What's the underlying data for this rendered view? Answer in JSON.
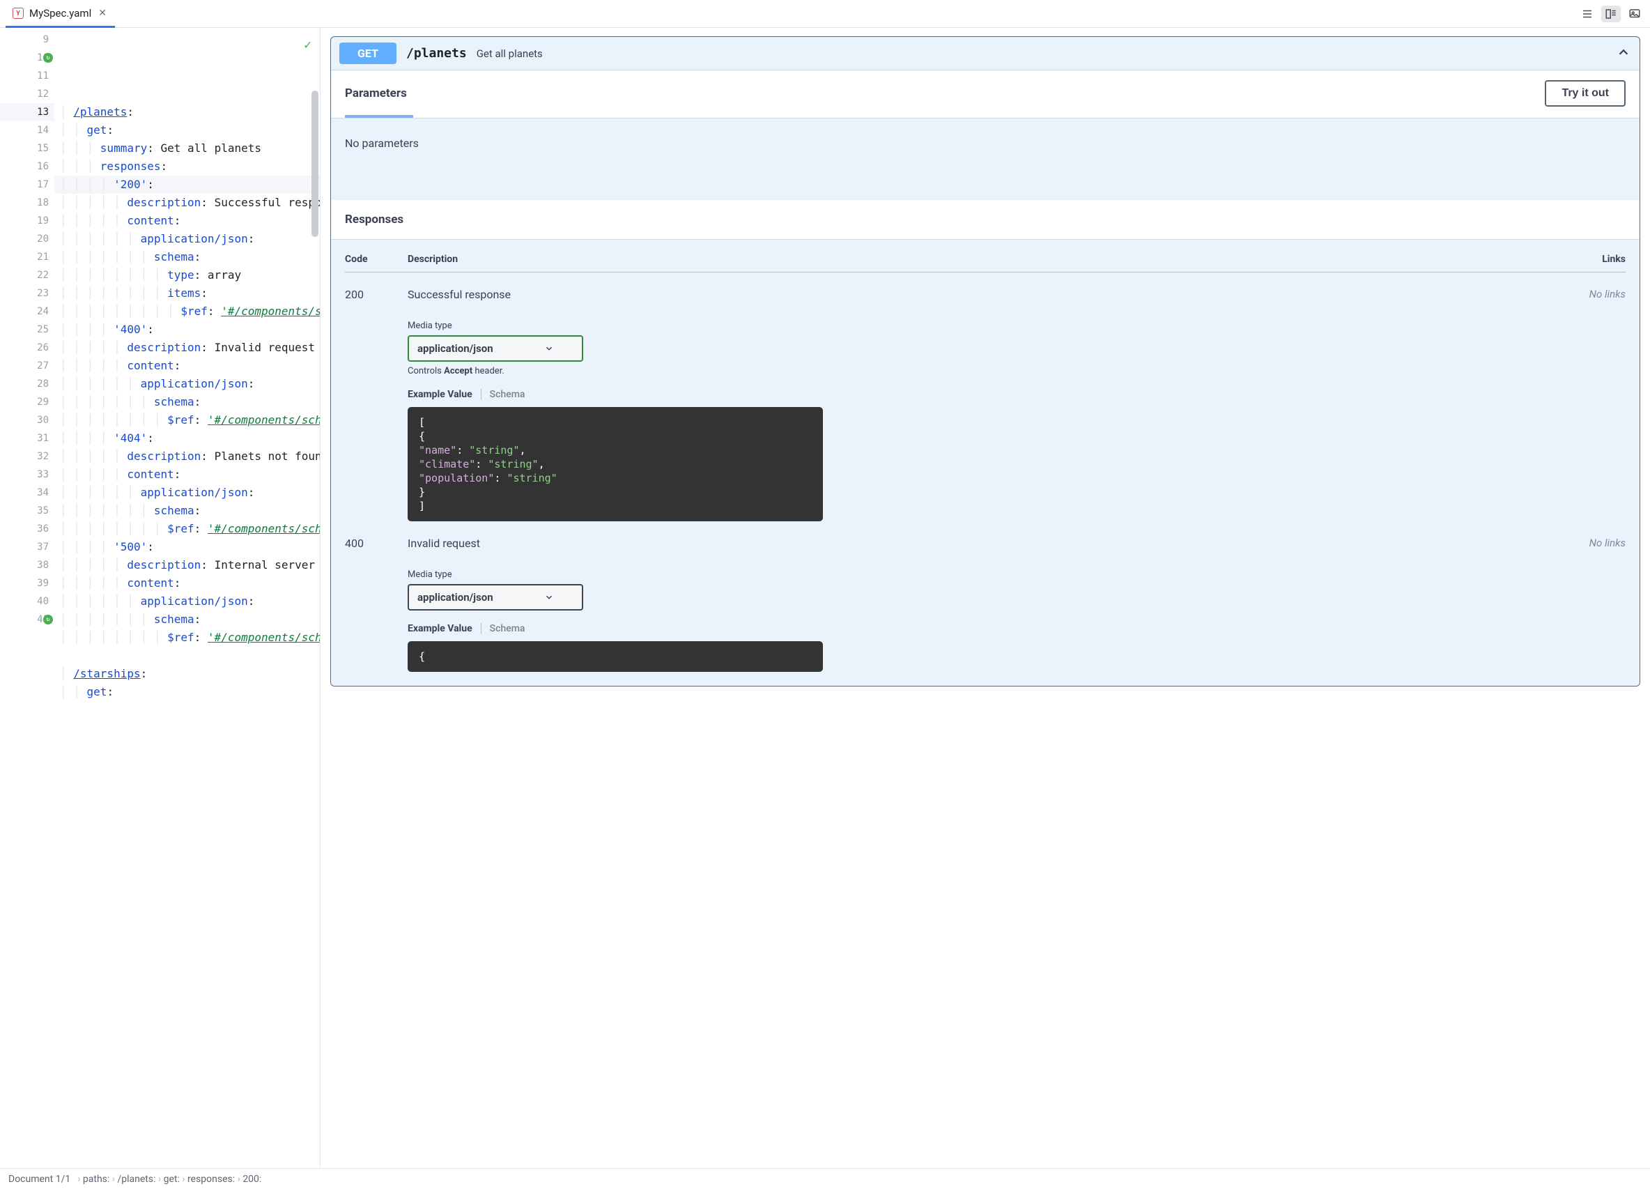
{
  "tab": {
    "filename": "MySpec.yaml"
  },
  "editor": {
    "lines": [
      {
        "n": 9,
        "indent": 1,
        "tokens": [
          {
            "t": "path",
            "v": "/planets"
          },
          {
            "t": "colon",
            "v": ":"
          }
        ]
      },
      {
        "n": 10,
        "indent": 2,
        "gutterMark": true,
        "tokens": [
          {
            "t": "key",
            "v": "get"
          },
          {
            "t": "colon",
            "v": ":"
          }
        ]
      },
      {
        "n": 11,
        "indent": 3,
        "tokens": [
          {
            "t": "key",
            "v": "summary"
          },
          {
            "t": "colon",
            "v": ": "
          },
          {
            "t": "str",
            "v": "Get all planets"
          }
        ]
      },
      {
        "n": 12,
        "indent": 3,
        "tokens": [
          {
            "t": "key",
            "v": "responses"
          },
          {
            "t": "colon",
            "v": ":"
          }
        ]
      },
      {
        "n": 13,
        "indent": 4,
        "current": true,
        "tokens": [
          {
            "t": "quoted",
            "v": "'200'"
          },
          {
            "t": "colon",
            "v": ":"
          }
        ]
      },
      {
        "n": 14,
        "indent": 5,
        "tokens": [
          {
            "t": "key",
            "v": "description"
          },
          {
            "t": "colon",
            "v": ": "
          },
          {
            "t": "str",
            "v": "Successful response"
          }
        ]
      },
      {
        "n": 15,
        "indent": 5,
        "tokens": [
          {
            "t": "key",
            "v": "content"
          },
          {
            "t": "colon",
            "v": ":"
          }
        ]
      },
      {
        "n": 16,
        "indent": 6,
        "tokens": [
          {
            "t": "key",
            "v": "application/json"
          },
          {
            "t": "colon",
            "v": ":"
          }
        ]
      },
      {
        "n": 17,
        "indent": 7,
        "tokens": [
          {
            "t": "key",
            "v": "schema"
          },
          {
            "t": "colon",
            "v": ":"
          }
        ]
      },
      {
        "n": 18,
        "indent": 8,
        "tokens": [
          {
            "t": "key",
            "v": "type"
          },
          {
            "t": "colon",
            "v": ": "
          },
          {
            "t": "str",
            "v": "array"
          }
        ]
      },
      {
        "n": 19,
        "indent": 8,
        "tokens": [
          {
            "t": "key",
            "v": "items"
          },
          {
            "t": "colon",
            "v": ":"
          }
        ]
      },
      {
        "n": 20,
        "indent": 9,
        "tokens": [
          {
            "t": "key",
            "v": "$ref"
          },
          {
            "t": "colon",
            "v": ": "
          },
          {
            "t": "ref",
            "v": "'#/components/sche"
          }
        ]
      },
      {
        "n": 21,
        "indent": 4,
        "tokens": [
          {
            "t": "quoted",
            "v": "'400'"
          },
          {
            "t": "colon",
            "v": ":"
          }
        ]
      },
      {
        "n": 22,
        "indent": 5,
        "tokens": [
          {
            "t": "key",
            "v": "description"
          },
          {
            "t": "colon",
            "v": ": "
          },
          {
            "t": "str",
            "v": "Invalid request"
          }
        ]
      },
      {
        "n": 23,
        "indent": 5,
        "tokens": [
          {
            "t": "key",
            "v": "content"
          },
          {
            "t": "colon",
            "v": ":"
          }
        ]
      },
      {
        "n": 24,
        "indent": 6,
        "tokens": [
          {
            "t": "key",
            "v": "application/json"
          },
          {
            "t": "colon",
            "v": ":"
          }
        ]
      },
      {
        "n": 25,
        "indent": 7,
        "tokens": [
          {
            "t": "key",
            "v": "schema"
          },
          {
            "t": "colon",
            "v": ":"
          }
        ]
      },
      {
        "n": 26,
        "indent": 8,
        "tokens": [
          {
            "t": "key",
            "v": "$ref"
          },
          {
            "t": "colon",
            "v": ": "
          },
          {
            "t": "ref",
            "v": "'#/components/schema"
          }
        ]
      },
      {
        "n": 27,
        "indent": 4,
        "tokens": [
          {
            "t": "quoted",
            "v": "'404'"
          },
          {
            "t": "colon",
            "v": ":"
          }
        ]
      },
      {
        "n": 28,
        "indent": 5,
        "tokens": [
          {
            "t": "key",
            "v": "description"
          },
          {
            "t": "colon",
            "v": ": "
          },
          {
            "t": "str",
            "v": "Planets not found"
          }
        ]
      },
      {
        "n": 29,
        "indent": 5,
        "tokens": [
          {
            "t": "key",
            "v": "content"
          },
          {
            "t": "colon",
            "v": ":"
          }
        ]
      },
      {
        "n": 30,
        "indent": 6,
        "tokens": [
          {
            "t": "key",
            "v": "application/json"
          },
          {
            "t": "colon",
            "v": ":"
          }
        ]
      },
      {
        "n": 31,
        "indent": 7,
        "tokens": [
          {
            "t": "key",
            "v": "schema"
          },
          {
            "t": "colon",
            "v": ":"
          }
        ]
      },
      {
        "n": 32,
        "indent": 8,
        "tokens": [
          {
            "t": "key",
            "v": "$ref"
          },
          {
            "t": "colon",
            "v": ": "
          },
          {
            "t": "ref",
            "v": "'#/components/schema"
          }
        ]
      },
      {
        "n": 33,
        "indent": 4,
        "tokens": [
          {
            "t": "quoted",
            "v": "'500'"
          },
          {
            "t": "colon",
            "v": ":"
          }
        ]
      },
      {
        "n": 34,
        "indent": 5,
        "tokens": [
          {
            "t": "key",
            "v": "description"
          },
          {
            "t": "colon",
            "v": ": "
          },
          {
            "t": "str",
            "v": "Internal server err"
          }
        ]
      },
      {
        "n": 35,
        "indent": 5,
        "tokens": [
          {
            "t": "key",
            "v": "content"
          },
          {
            "t": "colon",
            "v": ":"
          }
        ]
      },
      {
        "n": 36,
        "indent": 6,
        "tokens": [
          {
            "t": "key",
            "v": "application/json"
          },
          {
            "t": "colon",
            "v": ":"
          }
        ]
      },
      {
        "n": 37,
        "indent": 7,
        "tokens": [
          {
            "t": "key",
            "v": "schema"
          },
          {
            "t": "colon",
            "v": ":"
          }
        ]
      },
      {
        "n": 38,
        "indent": 8,
        "tokens": [
          {
            "t": "key",
            "v": "$ref"
          },
          {
            "t": "colon",
            "v": ": "
          },
          {
            "t": "ref",
            "v": "'#/components/schema"
          }
        ]
      },
      {
        "n": 39,
        "indent": 0,
        "tokens": []
      },
      {
        "n": 40,
        "indent": 1,
        "tokens": [
          {
            "t": "path",
            "v": "/starships"
          },
          {
            "t": "colon",
            "v": ":"
          }
        ]
      },
      {
        "n": 41,
        "indent": 2,
        "gutterMark": true,
        "tokens": [
          {
            "t": "key",
            "v": "get"
          },
          {
            "t": "colon",
            "v": ":"
          }
        ]
      }
    ]
  },
  "preview": {
    "method": "GET",
    "path": "/planets",
    "summary": "Get all planets",
    "sections": {
      "parameters": "Parameters",
      "responses": "Responses"
    },
    "try_label": "Try it out",
    "no_params": "No parameters",
    "table_head": {
      "code": "Code",
      "desc": "Description",
      "links": "Links"
    },
    "no_links": "No links",
    "media_label": "Media type",
    "media_value": "application/json",
    "accept_note_pre": "Controls ",
    "accept_note_bold": "Accept",
    "accept_note_post": " header.",
    "ev_tab_active": "Example Value",
    "ev_tab_inactive": "Schema",
    "responses": [
      {
        "code": "200",
        "desc": "Successful response",
        "mediaGreen": true,
        "showAcceptNote": true,
        "example": [
          [
            {
              "t": "punct",
              "v": "["
            }
          ],
          [
            {
              "t": "punct",
              "v": "  {"
            }
          ],
          [
            {
              "t": "punct",
              "v": "    "
            },
            {
              "t": "key",
              "v": "\"name\""
            },
            {
              "t": "punct",
              "v": ": "
            },
            {
              "t": "str",
              "v": "\"string\""
            },
            {
              "t": "punct",
              "v": ","
            }
          ],
          [
            {
              "t": "punct",
              "v": "    "
            },
            {
              "t": "key",
              "v": "\"climate\""
            },
            {
              "t": "punct",
              "v": ": "
            },
            {
              "t": "str",
              "v": "\"string\""
            },
            {
              "t": "punct",
              "v": ","
            }
          ],
          [
            {
              "t": "punct",
              "v": "    "
            },
            {
              "t": "key",
              "v": "\"population\""
            },
            {
              "t": "punct",
              "v": ": "
            },
            {
              "t": "str",
              "v": "\"string\""
            }
          ],
          [
            {
              "t": "punct",
              "v": "  }"
            }
          ],
          [
            {
              "t": "punct",
              "v": "]"
            }
          ]
        ]
      },
      {
        "code": "400",
        "desc": "Invalid request",
        "mediaGreen": false,
        "showAcceptNote": false,
        "example": [
          [
            {
              "t": "punct",
              "v": "{"
            }
          ]
        ]
      }
    ]
  },
  "breadcrumb": {
    "doc": "Document 1/1",
    "parts": [
      "paths:",
      "/planets:",
      "get:",
      "responses:",
      "200:"
    ]
  }
}
